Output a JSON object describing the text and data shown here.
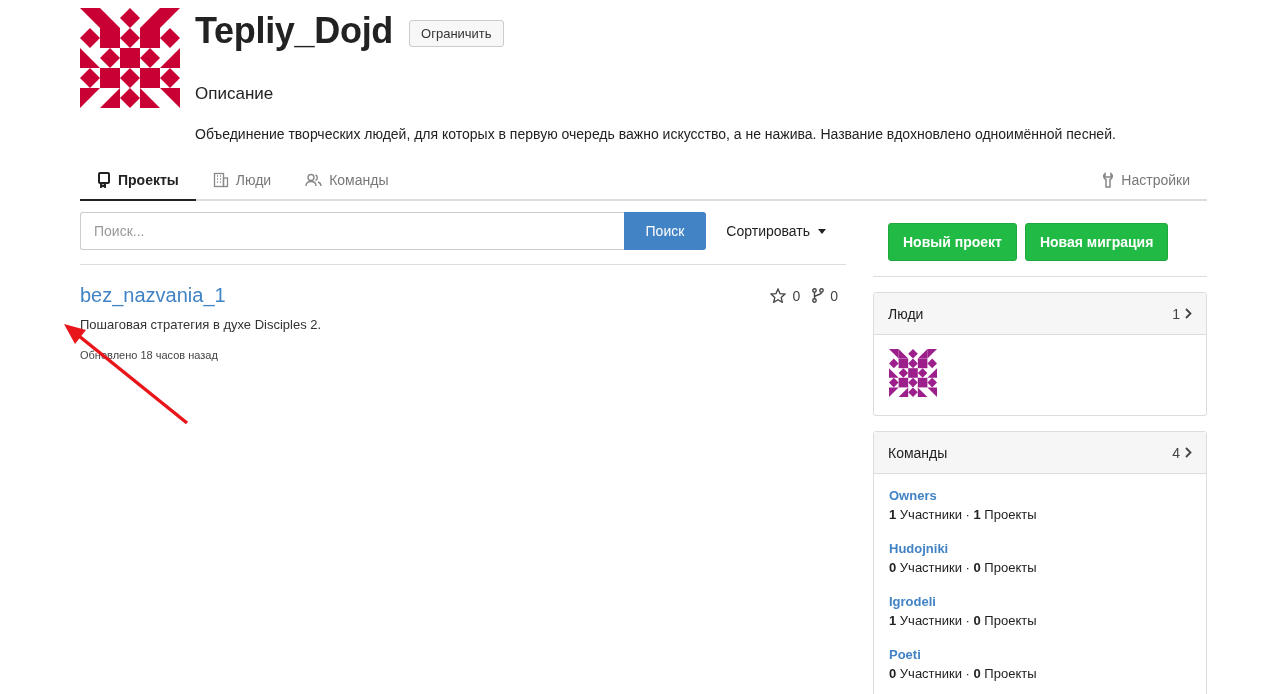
{
  "org": {
    "name": "Tepliy_Dojd",
    "restrict_button": "Ограничить",
    "description_heading": "Описание",
    "description": "Объединение творческих людей, для которых в первую очередь важно искусство, а не нажива. Название вдохновлено одноимённой песней."
  },
  "tabs": [
    {
      "label": "Проекты",
      "selected": true
    },
    {
      "label": "Люди",
      "selected": false
    },
    {
      "label": "Команды",
      "selected": false
    }
  ],
  "settings_link": "Настройки",
  "search": {
    "placeholder": "Поиск...",
    "button": "Поиск",
    "sort": "Сортировать"
  },
  "actions": [
    "Новый проект",
    "Новая миграция"
  ],
  "projects": [
    {
      "name": "bez_nazvania_1",
      "stars": "0",
      "forks": "0",
      "description": "Пошаговая стратегия в духе Disciples 2.",
      "updated": "Обновлено 18 часов назад"
    }
  ],
  "panels": [
    {
      "kind": "people",
      "title": "Люди",
      "count": "1"
    },
    {
      "kind": "teams",
      "title": "Команды",
      "count": "4",
      "teams": [
        {
          "name": "Owners",
          "stats": "**1** Участники · **1** Проекты"
        },
        {
          "name": "Hudojniki",
          "stats": "**0** Участники · **0** Проекты"
        },
        {
          "name": "Igrodeli",
          "stats": "**1** Участники · **0** Проекты"
        },
        {
          "name": "Poeti",
          "stats": "**0** Участники · **0** Проекты"
        }
      ]
    }
  ],
  "annotation": {
    "kind": "arrow"
  }
}
